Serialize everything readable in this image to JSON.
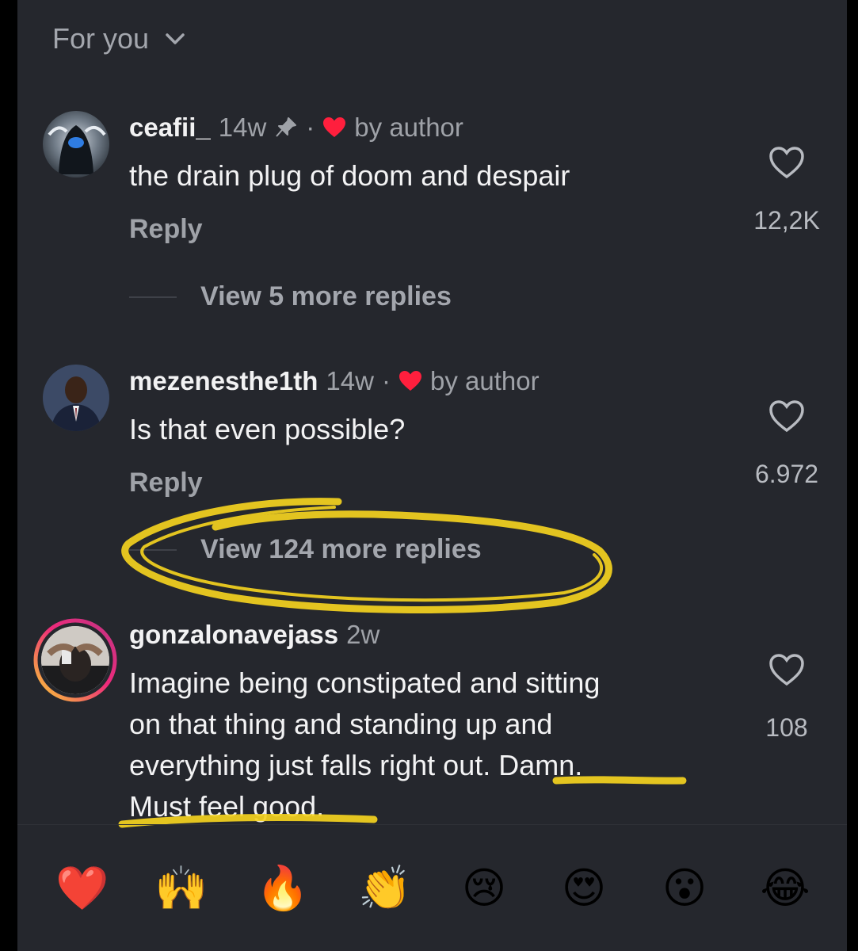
{
  "feed": {
    "filter_label": "For you",
    "filter_icon": "chevron-down-icon"
  },
  "comments": [
    {
      "username": "ceafii_",
      "time": "14w",
      "pinned": true,
      "author_like_label": "by author",
      "text": "the drain plug of doom and despair",
      "reply_label": "Reply",
      "like_count": "12,2K",
      "view_more_label": "View 5 more replies"
    },
    {
      "username": "mezenesthe1th",
      "time": "14w",
      "pinned": false,
      "author_like_label": "by author",
      "text": "Is that even possible?",
      "reply_label": "Reply",
      "like_count": "6.972",
      "view_more_label": "View 124 more replies"
    },
    {
      "username": "gonzalonavejass",
      "time": "2w",
      "text_lines": [
        "Imagine being constipated and sitting",
        "on that thing and standing up and",
        "everything just falls right out. Damn.",
        "Must feel good."
      ],
      "like_count": "108",
      "has_story_ring": true
    }
  ],
  "emoji_reactions": [
    "❤️",
    "🙌",
    "🔥",
    "👏",
    "😢",
    "😍",
    "😮",
    "😂"
  ],
  "colors": {
    "background": "#25272d",
    "author_heart": "#ff1f3d",
    "annotation_highlight": "#f4d21f",
    "story_ring": [
      "#f9ce34",
      "#ee2a7b",
      "#c13584"
    ]
  }
}
